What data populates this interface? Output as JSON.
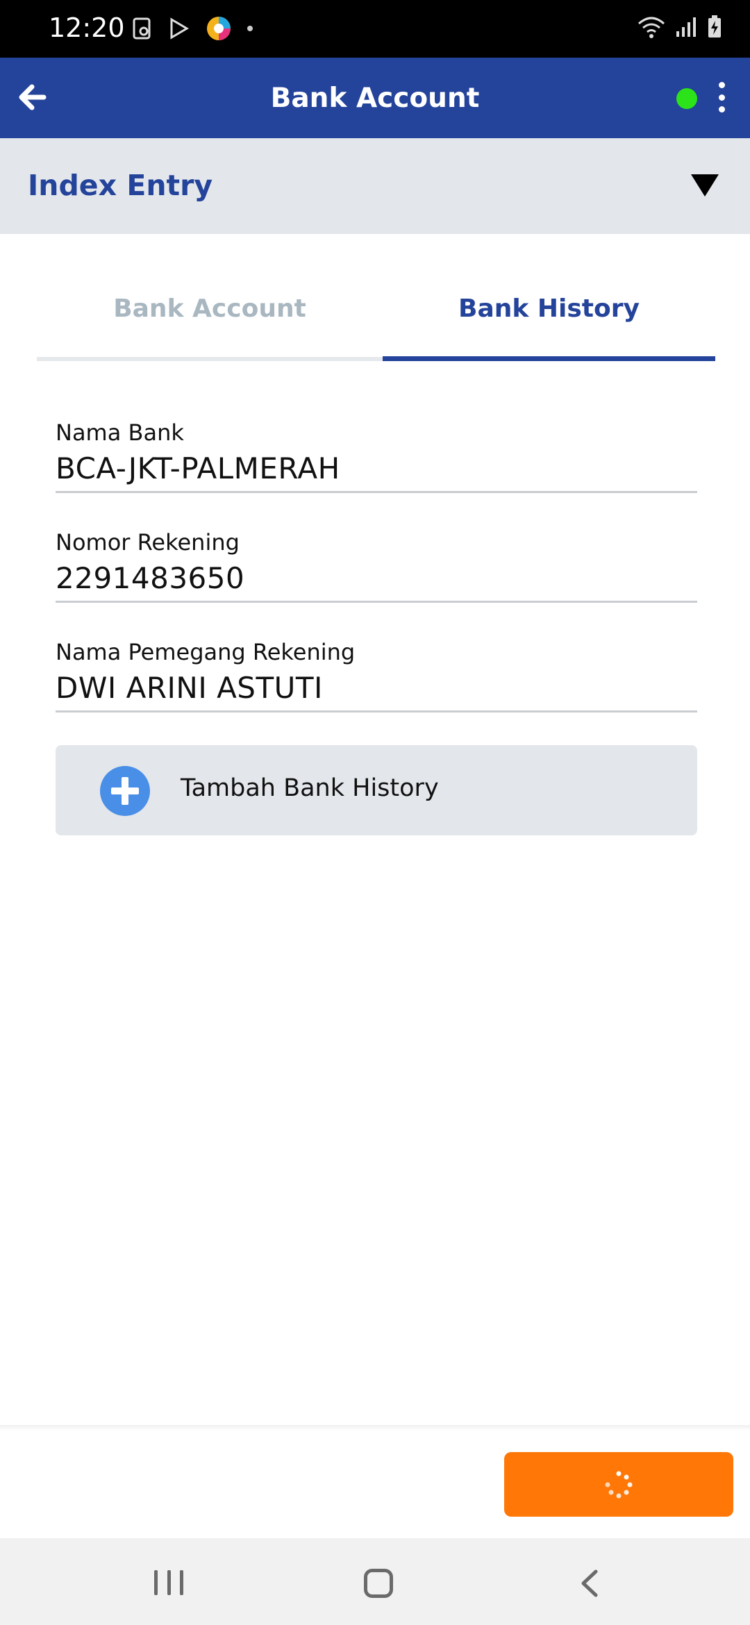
{
  "status_bar": {
    "time": "12:20"
  },
  "app_bar": {
    "title": "Bank Account",
    "online_color": "#2ce31a",
    "background_color": "#24439a"
  },
  "index_section": {
    "title": "Index Entry"
  },
  "tabs": [
    {
      "label": "Bank Account",
      "active": false
    },
    {
      "label": "Bank History",
      "active": true
    }
  ],
  "form": {
    "nama_bank": {
      "label": "Nama Bank",
      "value": "BCA-JKT-PALMERAH"
    },
    "nomor_rekening": {
      "label": "Nomor Rekening",
      "value": "2291483650"
    },
    "nama_pemegang": {
      "label": "Nama Pemegang Rekening",
      "value": "DWI ARINI ASTUTI"
    }
  },
  "add_history_button": {
    "label": "Tambah Bank History"
  },
  "submit_button": {
    "color": "#ff7707"
  }
}
